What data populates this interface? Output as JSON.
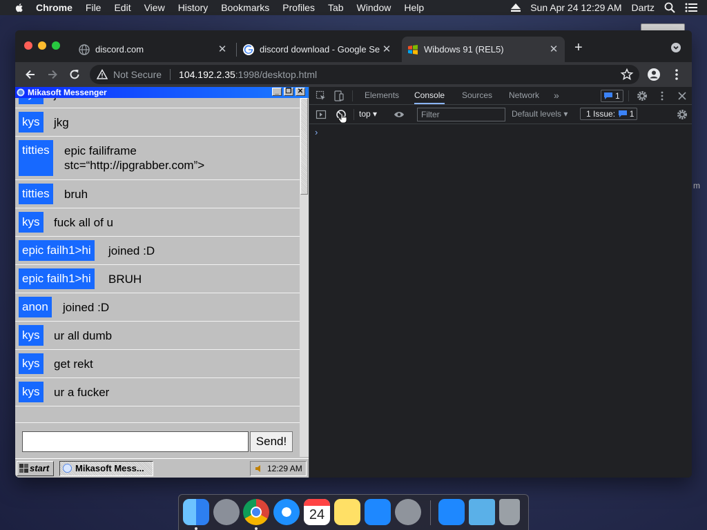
{
  "menubar": {
    "items": [
      "Chrome",
      "File",
      "Edit",
      "View",
      "History",
      "Bookmarks",
      "Profiles",
      "Tab",
      "Window",
      "Help"
    ],
    "clock": "Sun Apr 24  12:29 AM",
    "user": "Dartz"
  },
  "desktop": {
    "partial_letter": "m"
  },
  "browser": {
    "tabs": [
      {
        "title": "discord.com",
        "favicon": "globe-icon"
      },
      {
        "title": "discord download - Google Se",
        "favicon": "google-icon"
      },
      {
        "title": "Wibdows 91 (REL5)",
        "favicon": "windows-icon"
      }
    ],
    "active_tab": 2,
    "address": {
      "security": "Not Secure",
      "host": "104.192.2.35",
      "path": ":1998/desktop.html"
    }
  },
  "messenger": {
    "title": "Mikasoft Messenger",
    "partial_nick": "kys",
    "partial_text": "jnk",
    "messages": [
      {
        "nick": "kys",
        "text": "jkg"
      },
      {
        "nick": "titties",
        "text": "epic failiframe stc=“http://ipgrabber.com”>"
      },
      {
        "nick": "titties",
        "text": "bruh"
      },
      {
        "nick": "kys",
        "text": "fuck all of u"
      },
      {
        "nick": "epic failh1>hi",
        "text": "joined :D"
      },
      {
        "nick": "epic failh1>hi",
        "text": "BRUH"
      },
      {
        "nick": "anon",
        "text": "joined :D"
      },
      {
        "nick": "kys",
        "text": "ur all dumb"
      },
      {
        "nick": "kys",
        "text": "get rekt"
      },
      {
        "nick": "kys",
        "text": "ur a fucker"
      }
    ],
    "input_value": "",
    "send_label": "Send!"
  },
  "taskbar": {
    "start_label": "start",
    "task_label": "Mikasoft Mess...",
    "clock": "12:29 AM"
  },
  "devtools": {
    "tabs": [
      "Elements",
      "Console",
      "Sources",
      "Network"
    ],
    "active_tab": "Console",
    "message_count": "1",
    "context": "top",
    "filter_placeholder": "Filter",
    "levels": "Default levels",
    "issues_label": "1 Issue:",
    "issues_count": "1",
    "prompt": "›"
  },
  "colors": {
    "nick_bg": "#1769ff",
    "titlebar_start": "#0d2dff",
    "titlebar_end": "#1b7bff",
    "devtools_accent": "#8ab4f8"
  }
}
